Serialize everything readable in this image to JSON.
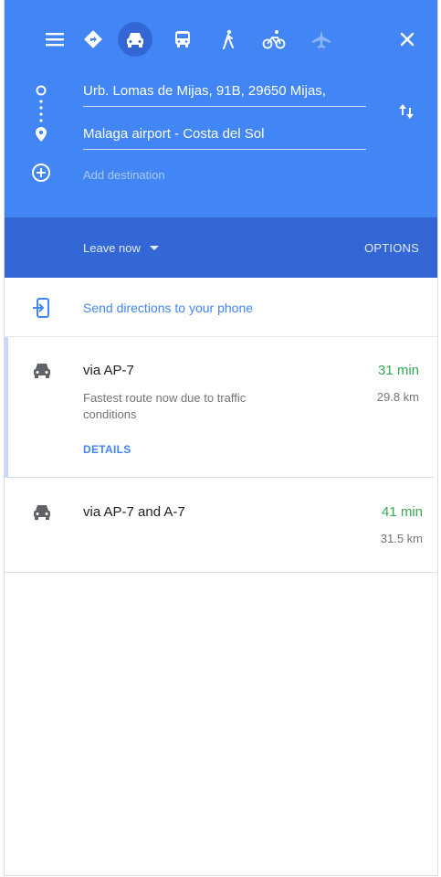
{
  "header": {
    "origin": "Urb. Lomas de Mijas, 91B, 29650 Mijas,",
    "destination": "Malaga airport - Costa del Sol",
    "add_destination_placeholder": "Add destination",
    "modes": [
      "directions-icon",
      "car-icon",
      "transit-icon",
      "walk-icon",
      "bike-icon",
      "flight-icon"
    ],
    "active_mode": "car-icon"
  },
  "bar": {
    "leave_label": "Leave now",
    "options_label": "OPTIONS"
  },
  "send": {
    "label": "Send directions to your phone"
  },
  "routes": [
    {
      "name": "via AP-7",
      "time": "31 min",
      "distance": "29.8 km",
      "description": "Fastest route now due to traffic conditions",
      "details_label": "DETAILS"
    },
    {
      "name": "via AP-7 and A-7",
      "time": "41 min",
      "distance": "31.5 km"
    }
  ],
  "colors": {
    "header": "#4285f4",
    "bar": "#3367d6",
    "time": "#34a853",
    "link": "#4285f4"
  }
}
